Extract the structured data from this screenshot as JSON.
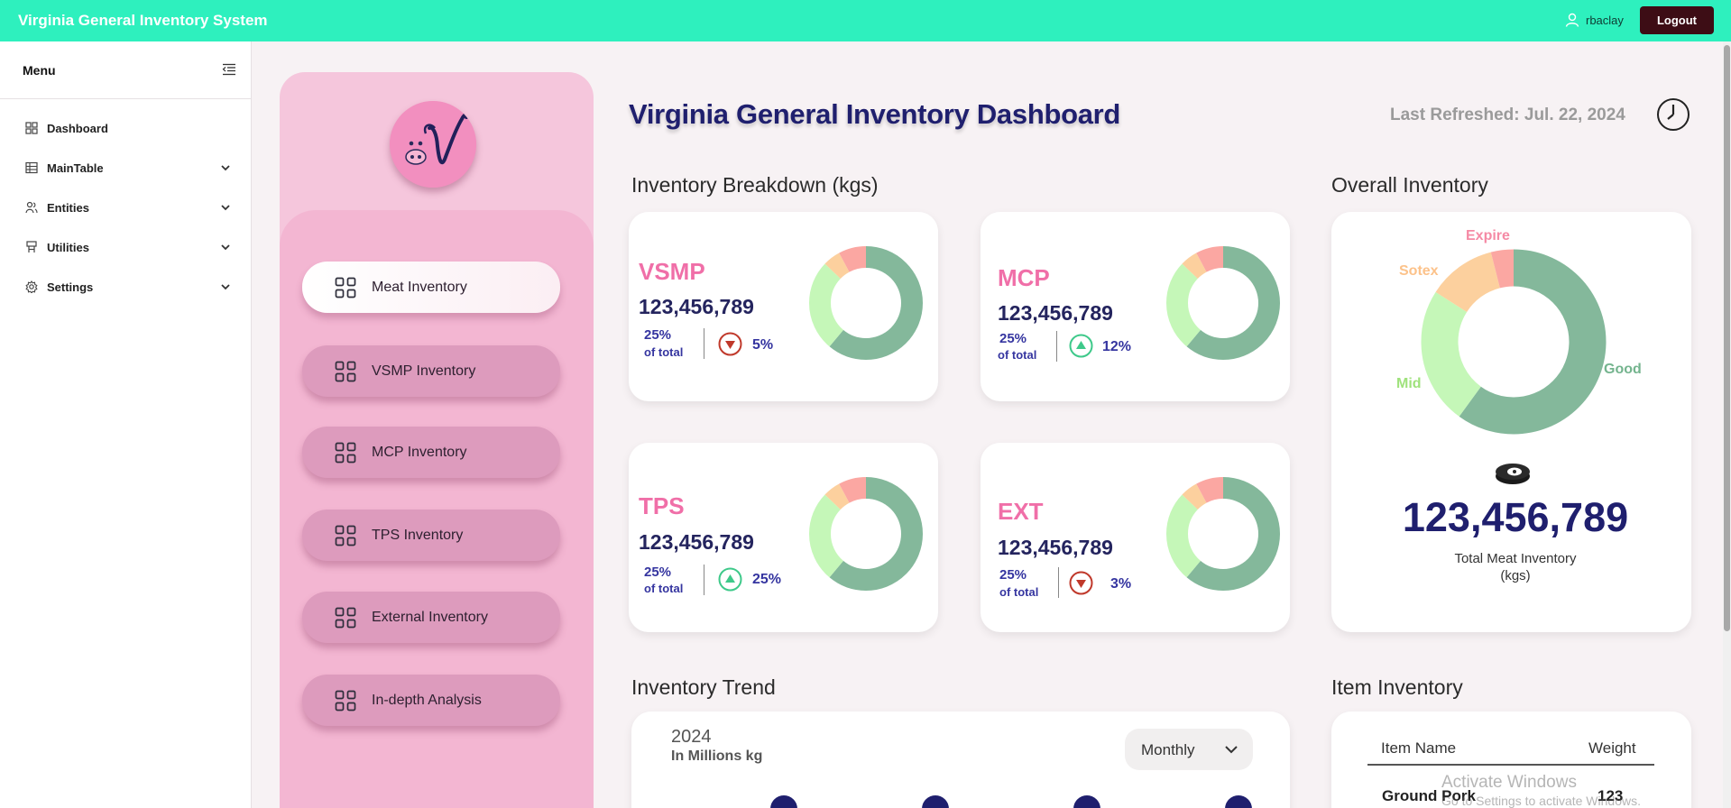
{
  "header": {
    "app_title": "Virginia General Inventory System",
    "username": "rbaclay",
    "logout_label": "Logout",
    "bg_color": "#2ef0be"
  },
  "sidebar": {
    "menu_title": "Menu",
    "items": [
      {
        "label": "Dashboard",
        "icon": "dashboard-icon",
        "has_chevron": false
      },
      {
        "label": "MainTable",
        "icon": "table-icon",
        "has_chevron": true
      },
      {
        "label": "Entities",
        "icon": "entities-icon",
        "has_chevron": true
      },
      {
        "label": "Utilities",
        "icon": "utilities-icon",
        "has_chevron": true
      },
      {
        "label": "Settings",
        "icon": "gear-icon",
        "has_chevron": true
      }
    ]
  },
  "side_panel": {
    "buttons": [
      {
        "label": "Meat Inventory",
        "active": true
      },
      {
        "label": "VSMP Inventory",
        "active": false
      },
      {
        "label": "MCP Inventory",
        "active": false
      },
      {
        "label": "TPS Inventory",
        "active": false
      },
      {
        "label": "External Inventory",
        "active": false
      },
      {
        "label": "In-depth Analysis",
        "active": false
      }
    ]
  },
  "main": {
    "title": "Virginia General Inventory Dashboard",
    "last_refreshed": "Last Refreshed: Jul. 22, 2024",
    "breakdown_title": "Inventory Breakdown (kgs)",
    "overall_title": "Overall Inventory",
    "trend_title": "Inventory Trend",
    "item_title": "Item Inventory"
  },
  "breakdown": [
    {
      "name": "VSMP",
      "value": "123,456,789",
      "pct": "25%",
      "pct_sub": "of total",
      "trend": "down",
      "change": "5%"
    },
    {
      "name": "MCP",
      "value": "123,456,789",
      "pct": "25%",
      "pct_sub": "of total",
      "trend": "up",
      "change": "12%"
    },
    {
      "name": "TPS",
      "value": "123,456,789",
      "pct": "25%",
      "pct_sub": "of total",
      "trend": "up",
      "change": "25%"
    },
    {
      "name": "EXT",
      "value": "123,456,789",
      "pct": "25%",
      "pct_sub": "of total",
      "trend": "down",
      "change": "3%"
    }
  ],
  "overall": {
    "segments": [
      {
        "label": "Good",
        "fraction": 0.6,
        "color": "#84b89b"
      },
      {
        "label": "Mid",
        "fraction": 0.24,
        "color": "#c5f7b8"
      },
      {
        "label": "Sotex",
        "fraction": 0.12,
        "color": "#fcd09e"
      },
      {
        "label": "Expire",
        "fraction": 0.04,
        "color": "#fba7a2"
      }
    ],
    "total_value": "123,456,789",
    "total_label_line1": "Total Meat Inventory",
    "total_label_line2": "(kgs)",
    "icon": "steak-icon"
  },
  "mini_donut_segments": [
    {
      "fraction": 0.61,
      "color": "#84b89b"
    },
    {
      "fraction": 0.26,
      "color": "#c5f7b8"
    },
    {
      "fraction": 0.05,
      "color": "#fcd09e"
    },
    {
      "fraction": 0.08,
      "color": "#fba7a2"
    }
  ],
  "trend": {
    "year": "2024",
    "unit": "In Millions kg",
    "period": "Monthly"
  },
  "item_inventory": {
    "columns": [
      "Item Name",
      "Weight"
    ],
    "rows": [
      [
        "Ground Pork",
        "123"
      ]
    ]
  },
  "watermark": {
    "title": "Activate Windows",
    "subtitle": "Go to Settings to activate Windows."
  },
  "colors": {
    "accent_pink": "#f06fa8",
    "navy": "#1f1f6e",
    "trend_up": "#3ec98a",
    "trend_down": "#c0392b"
  }
}
